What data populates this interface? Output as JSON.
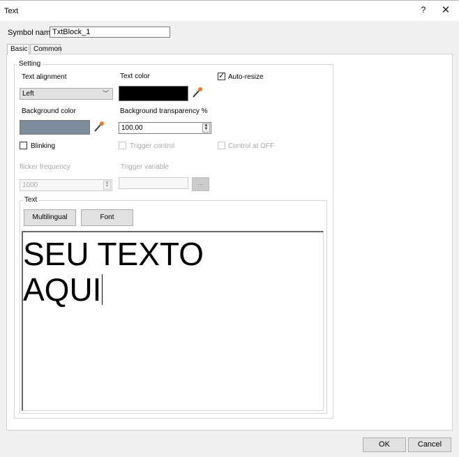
{
  "window": {
    "title": "Text",
    "help": "?",
    "close": "✕"
  },
  "symbol_name": {
    "label": "Symbol name",
    "value": "TxtBlock_1"
  },
  "tabs": [
    {
      "label": "Basic",
      "active": true
    },
    {
      "label": "Common",
      "active": false
    }
  ],
  "setting": {
    "legend": "Setting",
    "text_alignment": {
      "label": "Text alignment",
      "value": "Left"
    },
    "text_color": {
      "label": "Text color",
      "color": "#000000"
    },
    "auto_resize": {
      "label": "Auto-resize",
      "checked": true
    },
    "background_color": {
      "label": "Background color",
      "color": "#7d8b9b"
    },
    "background_transparency": {
      "label": "Background transparency %",
      "value": "100.00"
    },
    "blinking": {
      "label": "Blinking",
      "checked": false
    },
    "trigger_control": {
      "label": "Trigger control",
      "checked": false,
      "enabled": false
    },
    "control_at_off": {
      "label": "Control at OFF",
      "checked": false,
      "enabled": false
    },
    "flicker_frequency": {
      "label": "flicker frequency",
      "value": "1000",
      "enabled": false
    },
    "trigger_variable": {
      "label": "Trigger variable",
      "value": "",
      "browse_label": "...",
      "enabled": false
    }
  },
  "text_group": {
    "legend": "Text",
    "multilingual_label": "Multilingual",
    "font_label": "Font",
    "content_line1": "SEU TEXTO",
    "content_line2": "AQUI"
  },
  "footer": {
    "ok_label": "OK",
    "cancel_label": "Cancel"
  },
  "icons": {
    "pipette": "pipette-icon",
    "spin": "spin-updown-icon",
    "dropdown": "chevron-down-icon"
  }
}
